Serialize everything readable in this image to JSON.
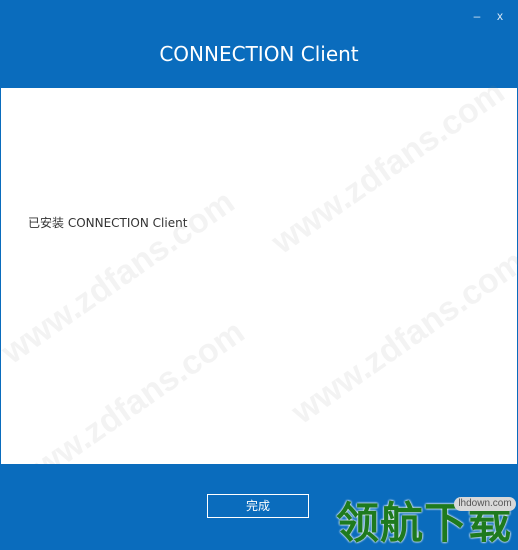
{
  "window": {
    "title": "CONNECTION Client",
    "minimize_label": "–",
    "close_label": "x"
  },
  "content": {
    "status_text": "已安装 CONNECTION Client"
  },
  "footer": {
    "finish_label": "完成"
  },
  "watermark": {
    "text": "www.zdfans.com",
    "logo_badge": "lhdown.com",
    "logo_text": "领航下载"
  },
  "colors": {
    "accent": "#0a6cbd",
    "content_bg": "#ffffff",
    "text": "#333333",
    "logo_green": "#1e7a1e"
  }
}
